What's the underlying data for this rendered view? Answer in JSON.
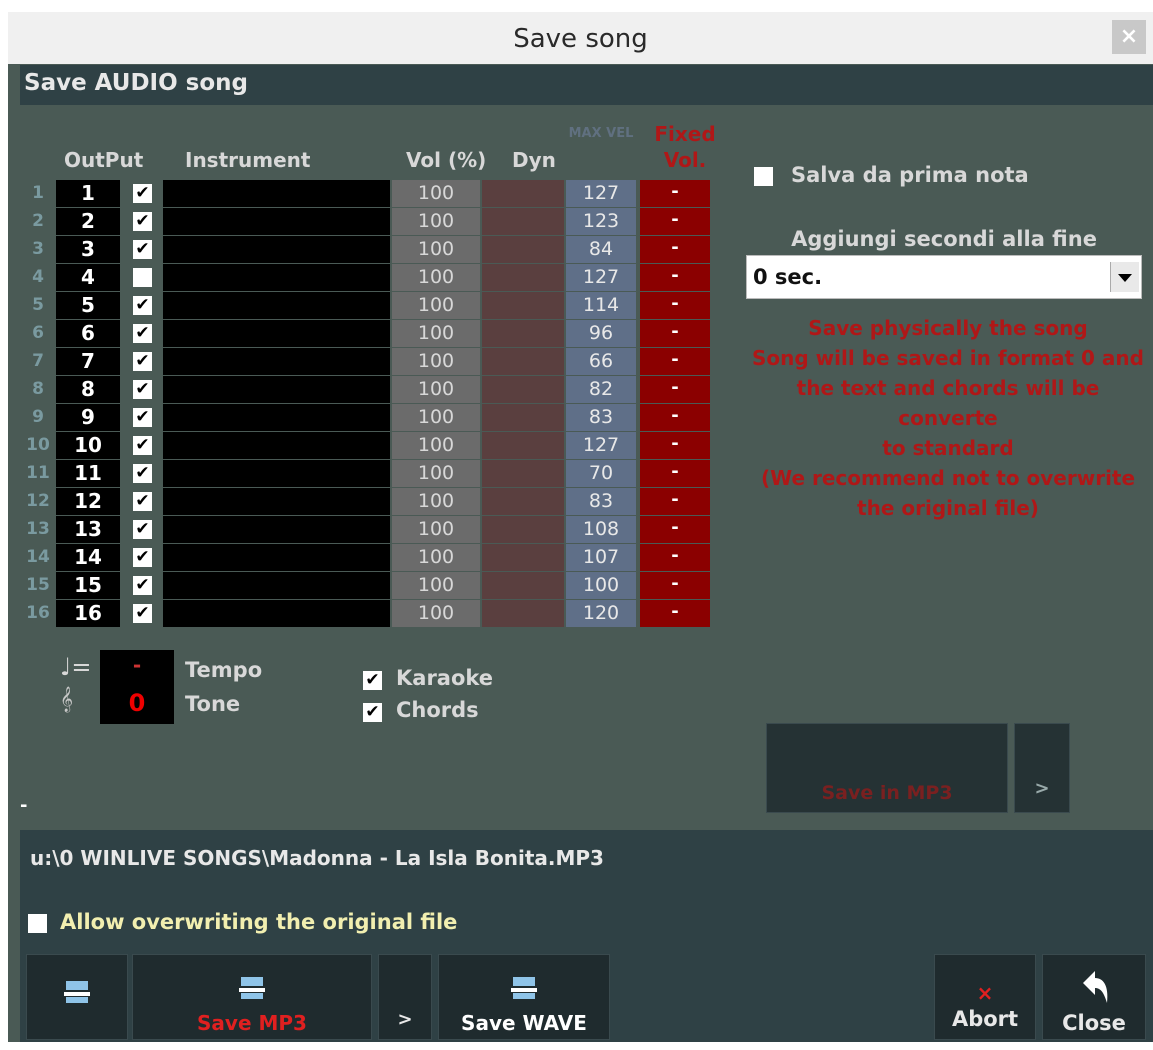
{
  "window": {
    "title": "Save song",
    "close_label": "×"
  },
  "section": {
    "title": "Save AUDIO song"
  },
  "table": {
    "headers": {
      "output": "OutPut",
      "instrument": "Instrument",
      "vol": "Vol (%)",
      "dyn": "Dyn",
      "vel": "MAX VEL",
      "fixed_line1": "Fixed",
      "fixed_line2": "Vol."
    },
    "rows": [
      {
        "num": "1",
        "out": "1",
        "checked": true,
        "vol": "100",
        "vel": "127",
        "fixed": "-"
      },
      {
        "num": "2",
        "out": "2",
        "checked": true,
        "vol": "100",
        "vel": "123",
        "fixed": "-"
      },
      {
        "num": "3",
        "out": "3",
        "checked": true,
        "vol": "100",
        "vel": "84",
        "fixed": "-"
      },
      {
        "num": "4",
        "out": "4",
        "checked": false,
        "vol": "100",
        "vel": "127",
        "fixed": "-"
      },
      {
        "num": "5",
        "out": "5",
        "checked": true,
        "vol": "100",
        "vel": "114",
        "fixed": "-"
      },
      {
        "num": "6",
        "out": "6",
        "checked": true,
        "vol": "100",
        "vel": "96",
        "fixed": "-"
      },
      {
        "num": "7",
        "out": "7",
        "checked": true,
        "vol": "100",
        "vel": "66",
        "fixed": "-"
      },
      {
        "num": "8",
        "out": "8",
        "checked": true,
        "vol": "100",
        "vel": "82",
        "fixed": "-"
      },
      {
        "num": "9",
        "out": "9",
        "checked": true,
        "vol": "100",
        "vel": "83",
        "fixed": "-"
      },
      {
        "num": "10",
        "out": "10",
        "checked": true,
        "vol": "100",
        "vel": "127",
        "fixed": "-"
      },
      {
        "num": "11",
        "out": "11",
        "checked": true,
        "vol": "100",
        "vel": "70",
        "fixed": "-"
      },
      {
        "num": "12",
        "out": "12",
        "checked": true,
        "vol": "100",
        "vel": "83",
        "fixed": "-"
      },
      {
        "num": "13",
        "out": "13",
        "checked": true,
        "vol": "100",
        "vel": "108",
        "fixed": "-"
      },
      {
        "num": "14",
        "out": "14",
        "checked": true,
        "vol": "100",
        "vel": "107",
        "fixed": "-"
      },
      {
        "num": "15",
        "out": "15",
        "checked": true,
        "vol": "100",
        "vel": "100",
        "fixed": "-"
      },
      {
        "num": "16",
        "out": "16",
        "checked": true,
        "vol": "100",
        "vel": "120",
        "fixed": "-"
      }
    ]
  },
  "tempo": {
    "value": "-",
    "label": "Tempo"
  },
  "tone": {
    "value": "0",
    "label": "Tone"
  },
  "options": {
    "karaoke": "Karaoke",
    "chords": "Chords",
    "check_mark": "✔"
  },
  "right": {
    "salva_label": "Salva da prima nota",
    "aggiungi_label": "Aggiungi secondi alla fine",
    "seconds_value": "0 sec.",
    "warning": [
      "Save physically the song",
      "Song will be saved in format 0 and",
      "the text and chords will be converte",
      "to standard",
      "(We recommend not to overwrite",
      "the original file)"
    ],
    "save_in_mp3": "Save in MP3",
    "more": ">"
  },
  "left_marker": "-",
  "path": "u:\\0 WINLIVE SONGS\\Madonna - La Isla Bonita.MP3",
  "allow_overwrite": "Allow overwriting the original file",
  "buttons": {
    "save_mp3": "Save MP3",
    "more": ">",
    "save_wave": "Save WAVE",
    "abort": "Abort",
    "close": "Close",
    "abort_icon": "×"
  },
  "colors": {
    "fixed_red": "#8b0000",
    "warning_red": "#b01717",
    "panel": "#4a5a55"
  }
}
